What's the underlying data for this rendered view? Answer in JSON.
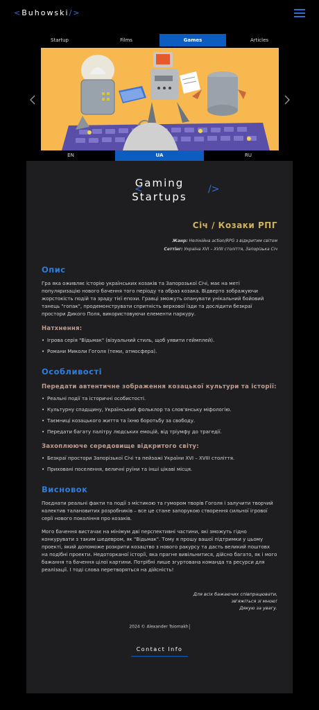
{
  "header": {
    "logo_open": "<",
    "logo_name": "Buhowski",
    "logo_close": "/>"
  },
  "category_tabs": [
    {
      "label": "Startup",
      "active": false
    },
    {
      "label": "Films",
      "active": false
    },
    {
      "label": "Games",
      "active": true
    },
    {
      "label": "Articles",
      "active": false
    }
  ],
  "language_tabs": [
    {
      "label": "EN",
      "active": false
    },
    {
      "label": "UA",
      "active": true
    },
    {
      "label": "RU",
      "active": false
    }
  ],
  "section_heading": {
    "open_bracket": "<",
    "line1": "Gaming",
    "line2": "Startups",
    "close_bracket": "/>"
  },
  "game": {
    "title": "Січ / Козаки РПГ",
    "genre_label": "Жанр:",
    "genre_value": "Нелінійна action/RPG з відкритим світом",
    "setting_label": "Сеттінг:",
    "setting_value": "Україна XVI – XVIII століття, Запорізька Січ"
  },
  "description": {
    "heading": "Опис",
    "text": "Гра яка оживляє історію українських козаків та Запорозької Січі, має на меті популяризацію нового бачення того періоду та образ козака. Відверто зображуючи жорстокість подій та зраду тієї епохи. Гравці зможуть опанувати унікальний бойовий танець \"гопак\", продемонструвати спритність верхової їзди та дослідити безкраї простори Дикого Поля, використовуючи елементи паркуру."
  },
  "inspiration": {
    "heading": "Натхнення:",
    "items": [
      "Ігрова серія \"Відьмак\" (візуальний стиль, щоб уявити геймплей).",
      "Романи Миколи Гоголя (теми, атмосфера)."
    ]
  },
  "features": {
    "heading": "Особливості",
    "group1": {
      "heading": "Передати автентичне зображення козацької культури та історії:",
      "items": [
        "Реальні події та історичні особистості.",
        "Культурну спадщину, Український фольклор та слов'янську міфологію.",
        "Таємниці козацького життя та їхню боротьбу за свободу.",
        "Передати багату палітру людських емоцій, від тріумфу до трагедії."
      ]
    },
    "group2": {
      "heading": "Захоплююче середовище відкритого світу:",
      "items": [
        "Безкраї простори Запорізької Січі та пейзажі України XVI – XVIII століття.",
        "Приховані поселення, величні руїни та інші цікаві місця."
      ]
    }
  },
  "conclusion": {
    "heading": "Висновок",
    "p1": "Поєднати реальні факти та події з містикою та гумором творів Гоголя і залучити творчий колектив талановитих розробників – все це стане запорукою створення сильної ігрової серії нового покоління про козаків.",
    "p2": "Мого бачення вистачає на мінімум дві перспективні частини, які зможуть гідно конкурувати з таким шедевром, як \"Відьмак\". Тому я прошу вашої підтримки у цьому проекті, який допоможе розкрити козацтво з нового ракурсу та дасть великий поштовх на подібні проекти. Недоторканої історії, яка прагне вивільнитися, дійсно багато, як і мого бажання та бачення цілої картини. Потрібні лише згуртована команда та ресурси для реалізації. І тоді слова перетворяться на дійсність!"
  },
  "closing": {
    "line1": "Для всіх бажаючих співпрацювати,",
    "line2": "зв'яжіться зі мною!",
    "line3": "Дякую за увагу."
  },
  "footer": {
    "copyright": "2024 © Alexander Tsiomakh",
    "contact_label": "Contact Info"
  },
  "colors": {
    "accent": "#0d5cc0",
    "link_blue": "#2f7ddb",
    "gold": "#cdb35e",
    "sub_heading": "#c59c8c",
    "panel_bg": "#1e1e20",
    "hero_bg": "#f7b84f"
  },
  "icons": {
    "menu": "hamburger-menu-icon",
    "prev": "chevron-left-icon",
    "next": "chevron-right-icon"
  }
}
